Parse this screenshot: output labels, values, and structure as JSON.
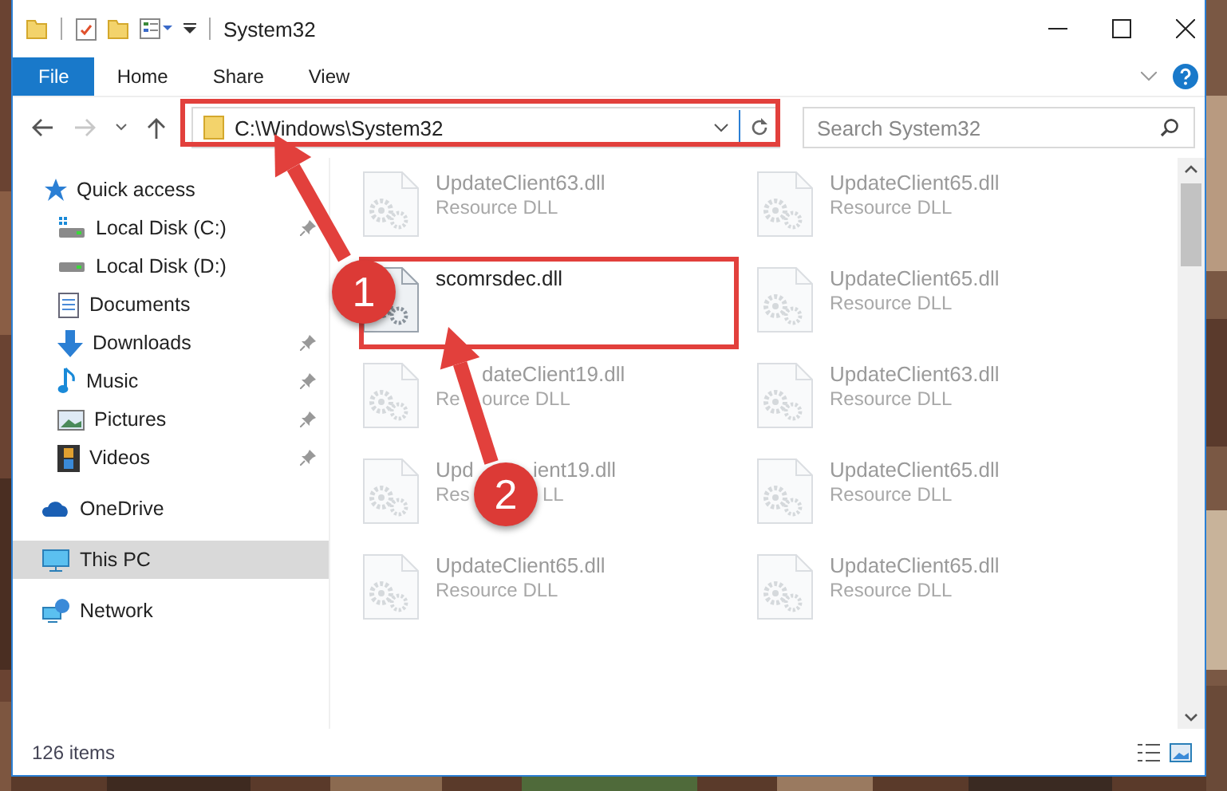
{
  "window": {
    "title": "System32"
  },
  "ribbon_tabs": [
    {
      "label": "File",
      "kind": "file"
    },
    {
      "label": "Home",
      "kind": "tab"
    },
    {
      "label": "Share",
      "kind": "tab"
    },
    {
      "label": "View",
      "kind": "tab"
    }
  ],
  "address": {
    "path": "C:\\Windows\\System32"
  },
  "search": {
    "placeholder": "Search System32"
  },
  "sidebar": {
    "items": [
      {
        "label": "Quick access",
        "kind": "star",
        "selected": false,
        "children": [
          {
            "label": "Local Disk (C:)",
            "kind": "system-drive",
            "pinned": true
          },
          {
            "label": "Local Disk (D:)",
            "kind": "drive",
            "pinned": false
          },
          {
            "label": "Documents",
            "kind": "documents",
            "pinned": false
          },
          {
            "label": "Downloads",
            "kind": "downloads",
            "pinned": true
          },
          {
            "label": "Music",
            "kind": "music",
            "pinned": true
          },
          {
            "label": "Pictures",
            "kind": "pictures",
            "pinned": true
          },
          {
            "label": "Videos",
            "kind": "videos",
            "pinned": true
          }
        ]
      },
      {
        "label": "OneDrive",
        "kind": "cloud",
        "selected": false
      },
      {
        "label": "This PC",
        "kind": "pc",
        "selected": true
      },
      {
        "label": "Network",
        "kind": "network",
        "selected": false
      }
    ]
  },
  "files": [
    {
      "name": "UpdateClient63.dll",
      "type": "Resource DLL",
      "faded": true
    },
    {
      "name": "UpdateClient65.dll",
      "type": "Resource DLL",
      "faded": true
    },
    {
      "name": "scomrsdec.dll",
      "faded": false
    },
    {
      "name": "UpdateClient65.dll",
      "type": "Resource DLL",
      "faded": true
    },
    {
      "name_parts": [
        "dateClient19.dll"
      ],
      "type_parts": [
        "Re",
        "ource DLL"
      ],
      "faded": true
    },
    {
      "name": "UpdateClient63.dll",
      "type": "Resource DLL",
      "faded": true
    },
    {
      "name_parts": [
        "Upd",
        "ient19.dll"
      ],
      "type_parts": [
        "Res",
        "LL"
      ],
      "faded": true
    },
    {
      "name": "UpdateClient65.dll",
      "type": "Resource DLL",
      "faded": true
    },
    {
      "name": "UpdateClient65.dll",
      "type": "Resource DLL",
      "faded": true
    },
    {
      "name": "UpdateClient65.dll",
      "type": "Resource DLL",
      "faded": true
    }
  ],
  "status_bar": {
    "item_count": "126 items"
  },
  "annotations": [
    {
      "number": "1"
    },
    {
      "number": "2"
    }
  ]
}
